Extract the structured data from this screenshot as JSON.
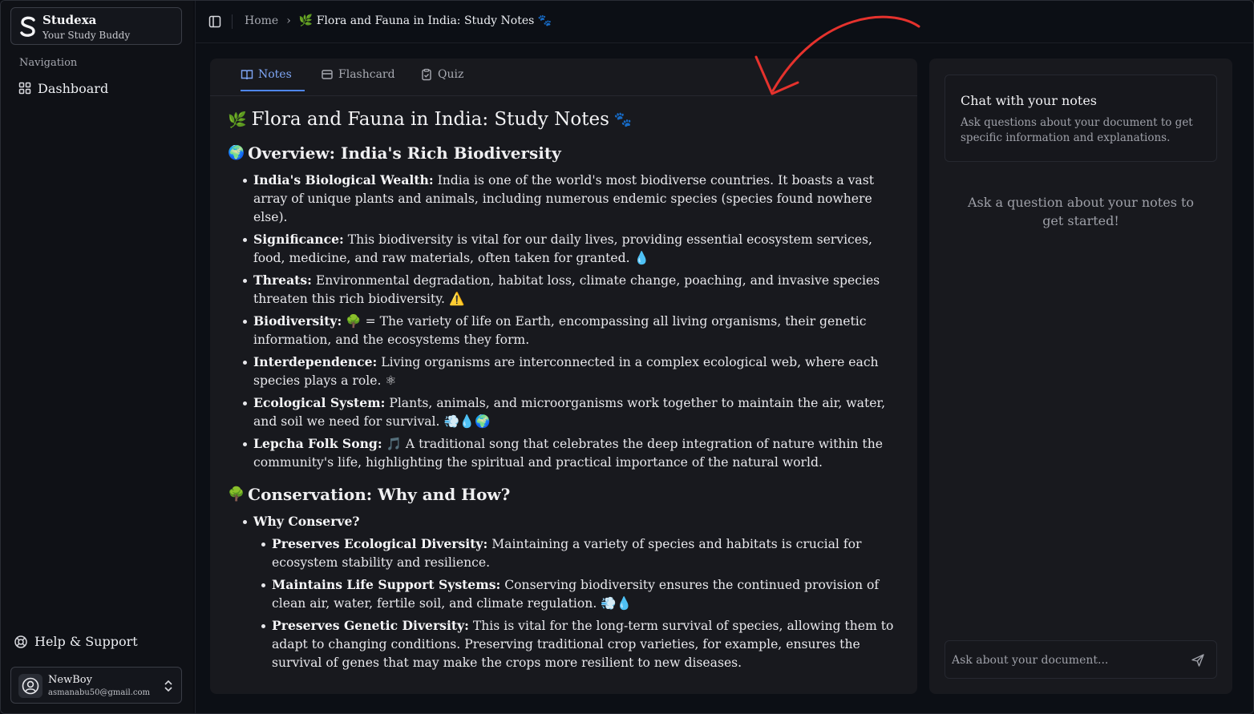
{
  "app": {
    "name": "Studexa",
    "tagline": "Your Study Buddy"
  },
  "sidebar": {
    "nav_label": "Navigation",
    "items": [
      {
        "label": "Dashboard",
        "icon": "grid-icon"
      }
    ],
    "help_label": "Help & Support",
    "user": {
      "name": "NewBoy",
      "email": "asmanabu50@gmail.com"
    }
  },
  "breadcrumb": {
    "home": "Home",
    "separator": "›",
    "current": "🌿 Flora and Fauna in India: Study Notes 🐾"
  },
  "tabs": [
    {
      "label": "Notes",
      "active": true
    },
    {
      "label": "Flashcard",
      "active": false
    },
    {
      "label": "Quiz",
      "active": false
    }
  ],
  "notes": {
    "title": "Flora and Fauna in India: Study Notes",
    "title_lead_emoji": "🌿",
    "title_trail_emoji": "🐾",
    "section1": {
      "emoji": "🌍",
      "heading": "Overview: India's Rich Biodiversity",
      "items": [
        {
          "term": "India's Biological Wealth:",
          "text": " India is one of the world's most biodiverse countries. It boasts a vast array of unique plants and animals, including numerous endemic species (species found nowhere else)."
        },
        {
          "term": "Significance:",
          "text": " This biodiversity is vital for our daily lives, providing essential ecosystem services, food, medicine, and raw materials, often taken for granted. 💧"
        },
        {
          "term": "Threats:",
          "text": " Environmental degradation, habitat loss, climate change, poaching, and invasive species threaten this rich biodiversity. ⚠️"
        },
        {
          "term": "Biodiversity:",
          "text": " 🌳 = The variety of life on Earth, encompassing all living organisms, their genetic information, and the ecosystems they form."
        },
        {
          "term": "Interdependence:",
          "text": " Living organisms are interconnected in a complex ecological web, where each species plays a role. ⚛"
        },
        {
          "term": "Ecological System:",
          "text": " Plants, animals, and microorganisms work together to maintain the air, water, and soil we need for survival. 💨💧🌍"
        },
        {
          "term": "Lepcha Folk Song:",
          "text": " 🎵 A traditional song that celebrates the deep integration of nature within the community's life, highlighting the spiritual and practical importance of the natural world."
        }
      ]
    },
    "section2": {
      "emoji": "🌳",
      "heading": "Conservation: Why and How?",
      "parent": "Why Conserve?",
      "items": [
        {
          "term": "Preserves Ecological Diversity:",
          "text": " Maintaining a variety of species and habitats is crucial for ecosystem stability and resilience."
        },
        {
          "term": "Maintains Life Support Systems:",
          "text": " Conserving biodiversity ensures the continued provision of clean air, water, fertile soil, and climate regulation. 💨💧"
        },
        {
          "term": "Preserves Genetic Diversity:",
          "text": " This is vital for the long-term survival of species, allowing them to adapt to changing conditions. Preserving traditional crop varieties, for example, ensures the survival of genes that may make the crops more resilient to new diseases."
        }
      ]
    }
  },
  "chat": {
    "title": "Chat with your notes",
    "description": "Ask questions about your document to get specific information and explanations.",
    "empty": "Ask a question about your notes to get started!",
    "placeholder": "Ask about your document..."
  },
  "colors": {
    "accent": "#4f86f0",
    "annotation": "#e5322d"
  }
}
